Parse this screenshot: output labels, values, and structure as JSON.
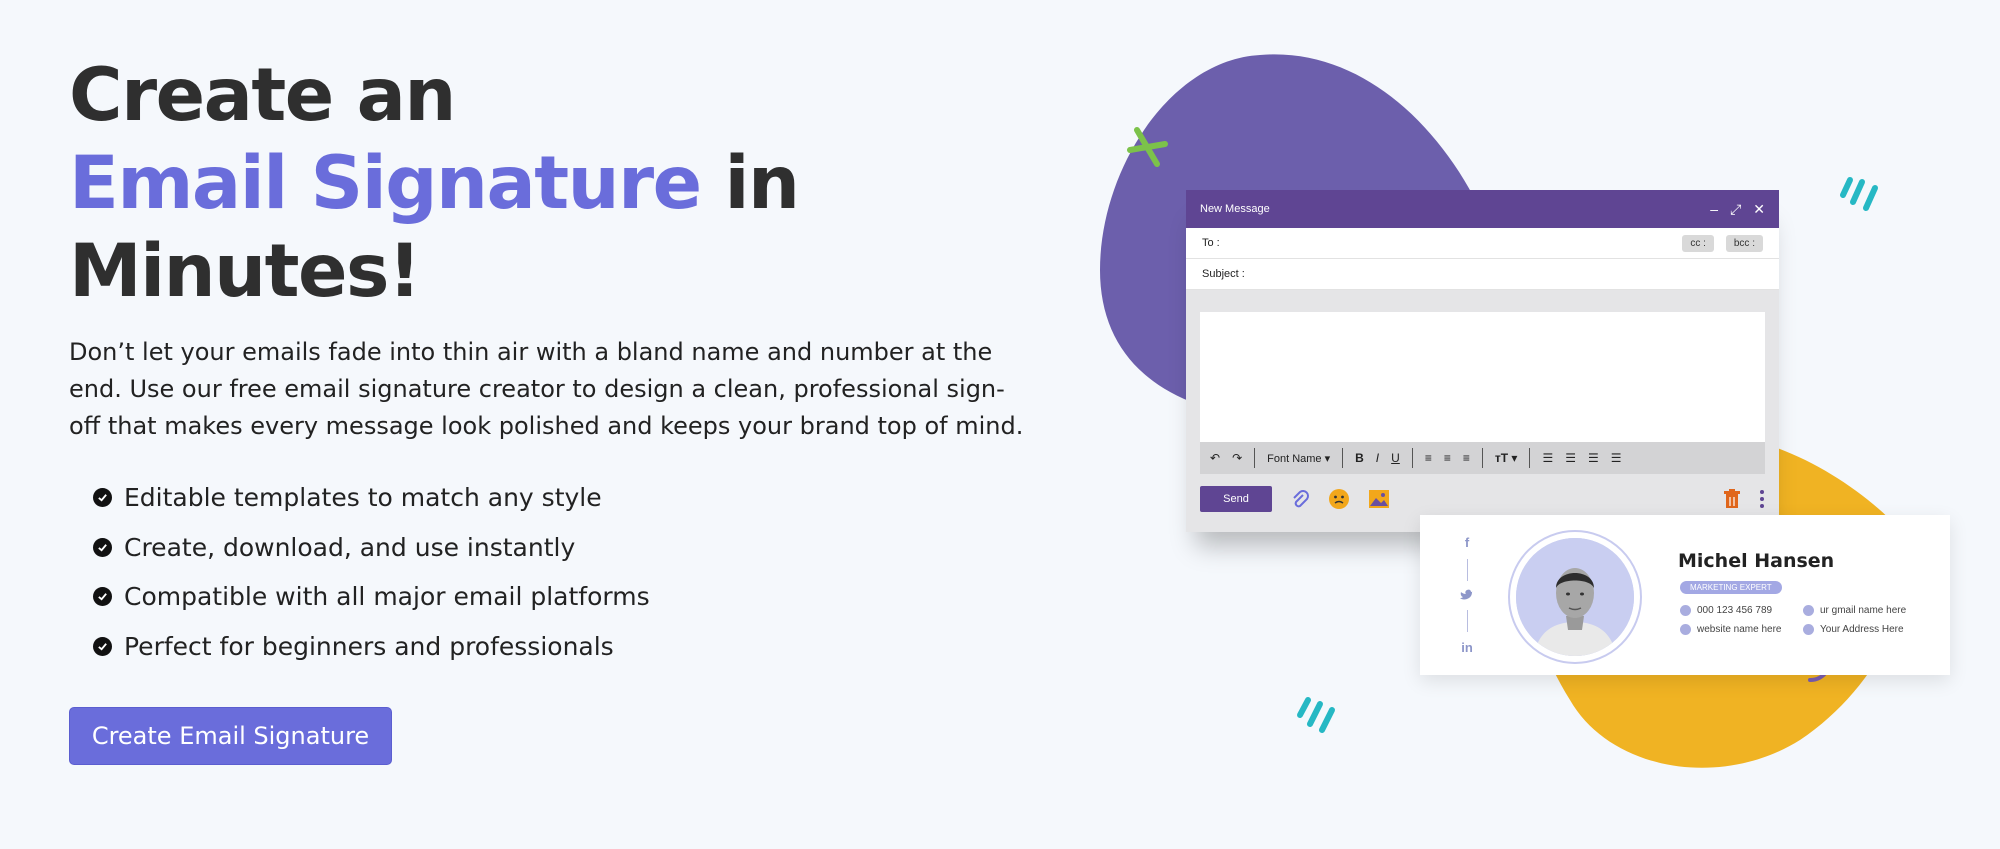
{
  "hero": {
    "title_line1": "Create an",
    "title_accent": "Email Signature",
    "title_in": " in",
    "title_line3": "Minutes!",
    "description": "Don’t let your emails fade into thin air with a bland name and number at the end. Use our free email signature creator to design a clean, professional sign-off that makes every message look polished and keeps your brand top of mind.",
    "features": [
      "Editable templates to match any style",
      "Create, download, and use instantly",
      "Compatible with all major email platforms",
      "Perfect for beginners and professionals"
    ],
    "cta_label": "Create Email Signature"
  },
  "email_window": {
    "title": "New Message",
    "to_label": "To :",
    "cc_label": "cc :",
    "bcc_label": "bcc :",
    "subject_label": "Subject :",
    "font_name": "Font Name",
    "send_label": "Send"
  },
  "signature": {
    "name": "Michel Hansen",
    "role": "MARKETING EXPERT",
    "phone": "000 123 456 789",
    "email": "ur gmail name here",
    "website": "website name here",
    "address": "Your Address Here"
  },
  "colors": {
    "accent": "#6a6ddb",
    "purple_blob": "#6c5fac",
    "yellow_blob": "#f0b323",
    "window_header": "#5f4593"
  }
}
